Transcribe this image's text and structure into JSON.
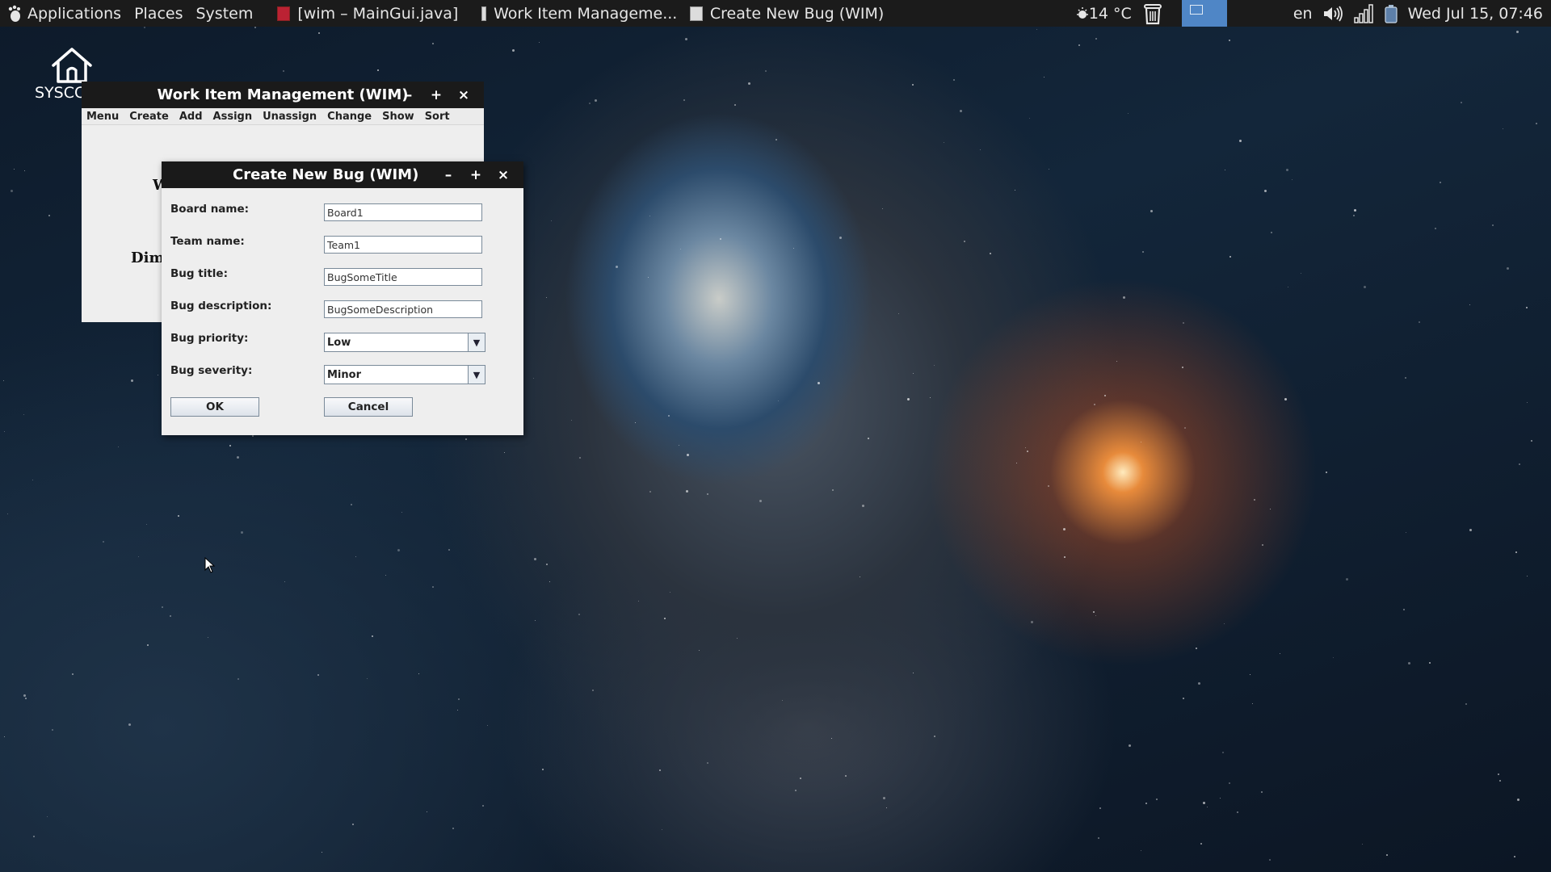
{
  "top_panel": {
    "menus": [
      "Applications",
      "Places",
      "System"
    ],
    "tasks": [
      {
        "label": "[wim – MainGui.java]",
        "icon": "java-file-icon"
      },
      {
        "label": "Work Item Manageme...",
        "icon": "java-app-icon"
      },
      {
        "label": "Create New Bug (WIM)",
        "icon": "java-app-icon"
      }
    ],
    "weather": "14 °C",
    "keyboard_layout": "en",
    "clock": "Wed Jul 15, 07:46"
  },
  "desktop": {
    "icons": [
      {
        "label": "SYSCC",
        "icon": "home-icon"
      }
    ]
  },
  "main_window": {
    "title": "Work Item Management (WIM)",
    "menu": [
      "Menu",
      "Create",
      "Add",
      "Assign",
      "Unassign",
      "Change",
      "Show",
      "Sort"
    ],
    "body_text": [
      "W",
      "Dim"
    ]
  },
  "dialog": {
    "title": "Create New Bug (WIM)",
    "fields": [
      {
        "label": "Board name:",
        "value": "Board1"
      },
      {
        "label": "Team name:",
        "value": "Team1"
      },
      {
        "label": "Bug title:",
        "value": "BugSomeTitle"
      },
      {
        "label": "Bug description:",
        "value": "BugSomeDescription"
      }
    ],
    "selects": [
      {
        "label": "Bug priority:",
        "value": "Low"
      },
      {
        "label": "Bug severity:",
        "value": "Minor"
      }
    ],
    "ok_label": "OK",
    "cancel_label": "Cancel"
  },
  "colors": {
    "panel_bg": "#1b1b1b",
    "pager_active": "#4f86c6",
    "titlebar_bg": "#1a1a1a",
    "window_bg": "#eeeeee"
  }
}
